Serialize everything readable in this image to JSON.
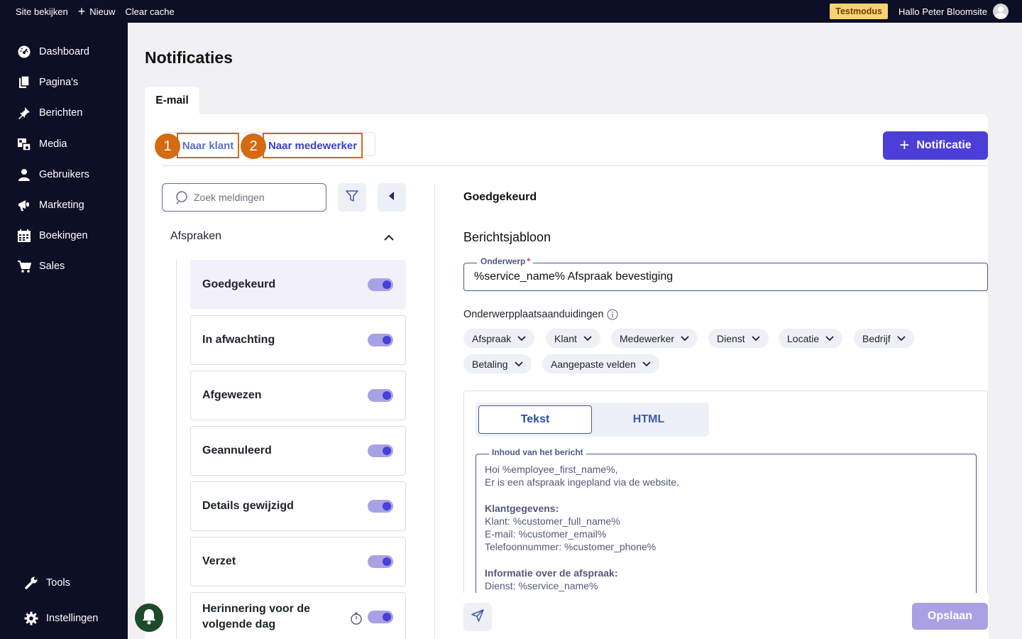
{
  "topbar": {
    "site_label": "Site bekijken",
    "new_label": "Nieuw",
    "cache_label": "Clear cache",
    "test_badge": "Testmodus",
    "greeting": "Hallo Peter Bloomsite"
  },
  "sidebar": {
    "items": [
      {
        "label": "Dashboard",
        "icon": "gauge-icon"
      },
      {
        "label": "Pagina's",
        "icon": "pages-icon"
      },
      {
        "label": "Berichten",
        "icon": "pin-icon"
      },
      {
        "label": "Media",
        "icon": "media-icon"
      },
      {
        "label": "Gebruikers",
        "icon": "user-icon"
      },
      {
        "label": "Marketing",
        "icon": "megaphone-icon"
      },
      {
        "label": "Boekingen",
        "icon": "calendar-icon"
      },
      {
        "label": "Sales",
        "icon": "cart-icon"
      }
    ],
    "tools_label": "Tools",
    "settings_label": "Instellingen"
  },
  "page": {
    "title": "Notificaties",
    "email_tab": "E-mail"
  },
  "recipient_tabs": {
    "customer": "Naar klant",
    "employee": "Naar medewerker",
    "marker_1": "1",
    "marker_2": "2"
  },
  "new_notification_label": "Notificatie",
  "search": {
    "placeholder": "Zoek meldingen"
  },
  "group": {
    "title": "Afspraken"
  },
  "notifications": [
    {
      "label": "Goedgekeurd",
      "enabled": true,
      "active": true
    },
    {
      "label": "In afwachting",
      "enabled": true
    },
    {
      "label": "Afgewezen",
      "enabled": true
    },
    {
      "label": "Geannuleerd",
      "enabled": true
    },
    {
      "label": "Details gewijzigd",
      "enabled": true
    },
    {
      "label": "Verzet",
      "enabled": true
    },
    {
      "label": "Herinnering voor de volgende dag",
      "enabled": true,
      "timer": true
    }
  ],
  "editor": {
    "heading": "Goedgekeurd",
    "section": "Berichtsjabloon",
    "subject_label": "Onderwerp",
    "subject_required": "*",
    "subject_value": "%service_name% Afspraak bevestiging",
    "placeholders_title": "Onderwerpplaatsaanduidingen",
    "placeholder_chips": [
      "Afspraak",
      "Klant",
      "Medewerker",
      "Dienst",
      "Locatie",
      "Bedrijf",
      "Betaling",
      "Aangepaste velden"
    ],
    "format_tabs": {
      "text": "Tekst",
      "html": "HTML"
    },
    "message_label": "Inhoud van het bericht",
    "message_lines": [
      {
        "text": "Hoi %employee_first_name%,",
        "bold": false
      },
      {
        "text": "Er is een afspraak ingepland via de website.",
        "bold": false
      },
      {
        "text": "",
        "bold": false
      },
      {
        "text": "Klantgegevens:",
        "bold": true
      },
      {
        "text": "Klant: %customer_full_name%",
        "bold": false
      },
      {
        "text": "E-mail: %customer_email%",
        "bold": false
      },
      {
        "text": "Telefoonnummer: %customer_phone%",
        "bold": false
      },
      {
        "text": "",
        "bold": false
      },
      {
        "text": "Informatie over de afspraak:",
        "bold": true
      },
      {
        "text": "Dienst: %service_name%",
        "bold": false
      }
    ],
    "save_label": "Opslaan"
  },
  "colors": {
    "primary": "#4b3fd8",
    "sidebar_bg": "#0d0f26",
    "marker": "#d46a12",
    "test_badge": "#f5d372"
  }
}
